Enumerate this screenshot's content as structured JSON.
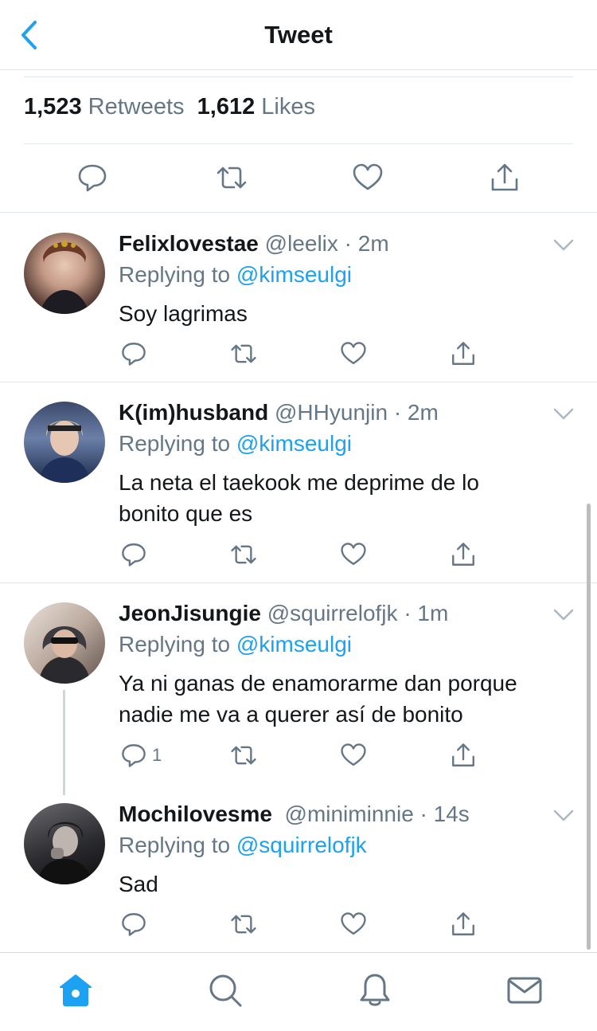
{
  "header": {
    "title": "Tweet"
  },
  "stats": {
    "retweets_count": "1,523",
    "retweets_label": "Retweets",
    "likes_count": "1,612",
    "likes_label": "Likes"
  },
  "replies": [
    {
      "name": "Felixlovestae",
      "handle": "@leelix",
      "time": "· 2m",
      "replying_prefix": "Replying to",
      "replying_to": "@kimseulgi",
      "text": "Soy lagrimas",
      "reply_count": ""
    },
    {
      "name": "K(im)husband",
      "handle": "@HHyunjin",
      "time": "· 2m",
      "replying_prefix": "Replying to",
      "replying_to": "@kimseulgi",
      "text": "La neta el taekook me deprime de lo bonito que es",
      "reply_count": ""
    },
    {
      "name": "JeonJisungie",
      "handle": "@squirrelofjk",
      "time": "· 1m",
      "replying_prefix": "Replying to",
      "replying_to": "@kimseulgi",
      "text": "Ya ni ganas de enamorarme dan porque nadie me va a querer así de bonito",
      "reply_count": "1"
    },
    {
      "name": "Mochilovesme",
      "handle": "@miniminnie",
      "time": "· 14s",
      "replying_prefix": "Replying to",
      "replying_to": "@squirrelofjk",
      "text": "Sad",
      "reply_count": ""
    }
  ],
  "tabs": [
    {
      "icon": "home-icon",
      "active": true
    },
    {
      "icon": "search-icon",
      "active": false
    },
    {
      "icon": "bell-icon",
      "active": false
    },
    {
      "icon": "mail-icon",
      "active": false
    }
  ],
  "colors": {
    "accent": "#1da1f2",
    "muted": "#657786",
    "text": "#14171a",
    "divider": "#e1e8ed"
  }
}
